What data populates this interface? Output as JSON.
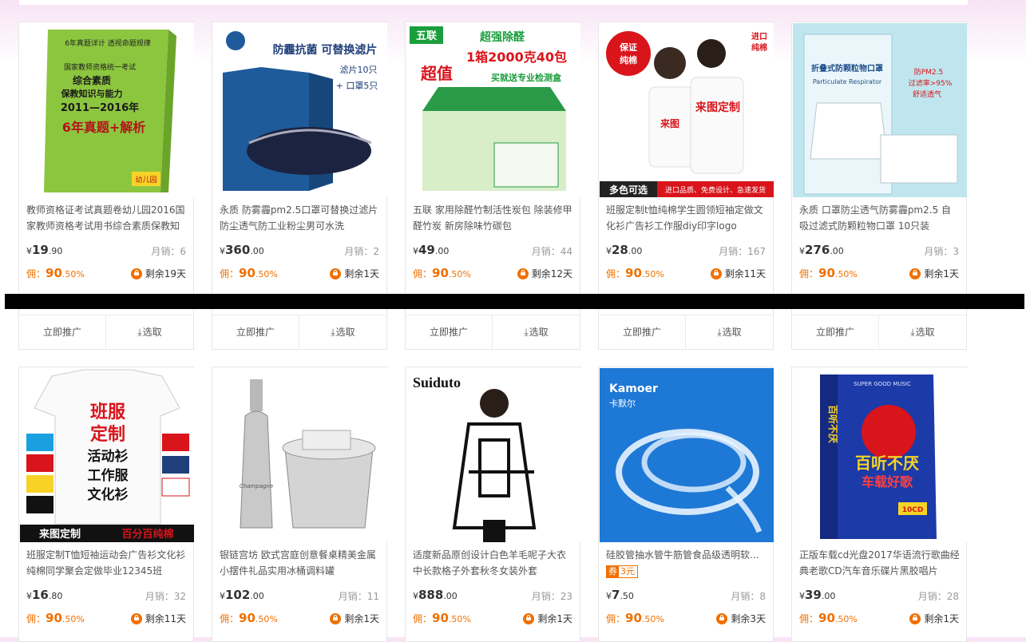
{
  "products": [
    {
      "title": "教师资格证考试真题卷幼儿园2016国家教师资格考试用书综合素质保教知",
      "price_int": "19",
      "price_dec": ".90",
      "sales": "6",
      "commission_int": "90",
      "commission_dec": ".50",
      "remaining": "剩余19天",
      "image": {
        "bg": "#ffffff",
        "accent": "#8cc63f",
        "text1": "6年真题详计 透视命题规律",
        "text2": "国家教师资格统一考试",
        "text3": "综合素质",
        "text4": "保教知识与能力",
        "text5": "2011—2016年",
        "text6": "6年真题+解析",
        "text7": "幼儿园"
      }
    },
    {
      "title": "永质 防雾霾pm2.5口罩可替换过滤片防尘透气防工业粉尘男可水洗",
      "price_int": "360",
      "price_dec": ".00",
      "sales": "2",
      "commission_int": "90",
      "commission_dec": ".50",
      "remaining": "剩余1天",
      "image": {
        "bg": "#ffffff",
        "accent": "#1f5a9a",
        "text1": "防霾抗菌 可替换滤片",
        "text2": "滤片10只",
        "text3": "+ 口罩5只"
      }
    },
    {
      "title": "五联 家用除醛竹制活性炭包 除装修甲醛竹炭 新房除味竹碳包",
      "price_int": "49",
      "price_dec": ".00",
      "sales": "44",
      "commission_int": "90",
      "commission_dec": ".50",
      "remaining": "剩余12天",
      "image": {
        "bg": "#ffffff",
        "accent": "#1a9e3c",
        "text1": "五联",
        "text2": "超强除醛",
        "text3": "1箱2000克40包",
        "text4": "超值",
        "text5": "买就送专业检测盒"
      }
    },
    {
      "title": "班服定制t恤纯棉学生圆领短袖定做文化衫广告衫工作服diy印字logo",
      "price_int": "28",
      "price_dec": ".00",
      "sales": "167",
      "commission_int": "90",
      "commission_dec": ".50",
      "remaining": "剩余11天",
      "image": {
        "bg": "#ffffff",
        "accent": "#d9141b",
        "text1": "保证纯棉",
        "text2": "进口纯棉",
        "text3": "来图定制",
        "text4": "多色可选",
        "text5": "进口品质、免费设计、急速发货"
      }
    },
    {
      "title": "永质 口罩防尘透气防雾霾pm2.5 自吸过滤式防颗粒物口罩 10只装",
      "price_int": "276",
      "price_dec": ".00",
      "sales": "3",
      "commission_int": "90",
      "commission_dec": ".50",
      "remaining": "剩余1天",
      "image": {
        "bg": "#bfe6ee",
        "accent": "#3a7fb7",
        "text1": "折叠式防颗粒物口罩",
        "text2": "Particulate Respirator",
        "text3": "防PM2.5",
        "text4": "过滤率>95%",
        "text5": "舒适透气"
      }
    },
    {
      "title": "班服定制T恤短袖运动会广告衫文化衫纯棉同学聚会定做毕业12345班",
      "price_int": "16",
      "price_dec": ".80",
      "sales": "32",
      "commission_int": "90",
      "commission_dec": ".50",
      "remaining": "剩余11天",
      "image": {
        "bg": "#ffffff",
        "accent": "#d9141b",
        "text1": "班服",
        "text2": "定制",
        "text3": "活动衫",
        "text4": "工作服",
        "text5": "文化衫",
        "text6": "来图定制",
        "text7": "百分百纯棉"
      }
    },
    {
      "title": "银链宫坊 欧式宫庭创意餐桌精美金属小摆件礼品实用冰桶调料罐",
      "price_int": "102",
      "price_dec": ".00",
      "sales": "11",
      "commission_int": "90",
      "commission_dec": ".50",
      "remaining": "剩余1天",
      "image": {
        "bg": "#ffffff",
        "accent": "#9a9a9a",
        "text1": "Champagne"
      }
    },
    {
      "title": "适度新品原创设计白色羊毛呢子大衣中长款格子外套秋冬女装外套",
      "price_int": "888",
      "price_dec": ".00",
      "sales": "23",
      "commission_int": "90",
      "commission_dec": ".50",
      "remaining": "剩余1天",
      "image": {
        "bg": "#ffffff",
        "accent": "#111111",
        "text1": "Suiduto"
      }
    },
    {
      "title": "硅胶管抽水管牛筋管食品级透明软...",
      "coupon_label": "券",
      "coupon_value": "3元",
      "price_int": "7",
      "price_dec": ".50",
      "sales": "8",
      "commission_int": "90",
      "commission_dec": ".50",
      "remaining": "剩余3天",
      "image": {
        "bg": "#1e78d6",
        "accent": "#ffffff",
        "text1": "Kamoer",
        "text2": "卡默尔"
      }
    },
    {
      "title": "正版车载cd光盘2017华语流行歌曲经典老歌CD汽车音乐碟片黑胶唱片",
      "price_int": "39",
      "price_dec": ".00",
      "sales": "28",
      "commission_int": "90",
      "commission_dec": ".50",
      "remaining": "剩余1天",
      "image": {
        "bg": "#ffffff",
        "accent": "#1c3aa8",
        "text1": "百听不厌",
        "text2": "车载好歌",
        "text3": "10CD",
        "text4": "SUPER GOOD MUSIC"
      }
    }
  ],
  "labels": {
    "currency": "¥",
    "sales_prefix": "月销：",
    "commission_prefix": "佣：",
    "percent": "%",
    "promote": "立即推广",
    "pick": "选取",
    "download_icon": "⤓"
  },
  "colors": {
    "accent": "#f07000",
    "text": "#555555",
    "muted": "#999999"
  }
}
